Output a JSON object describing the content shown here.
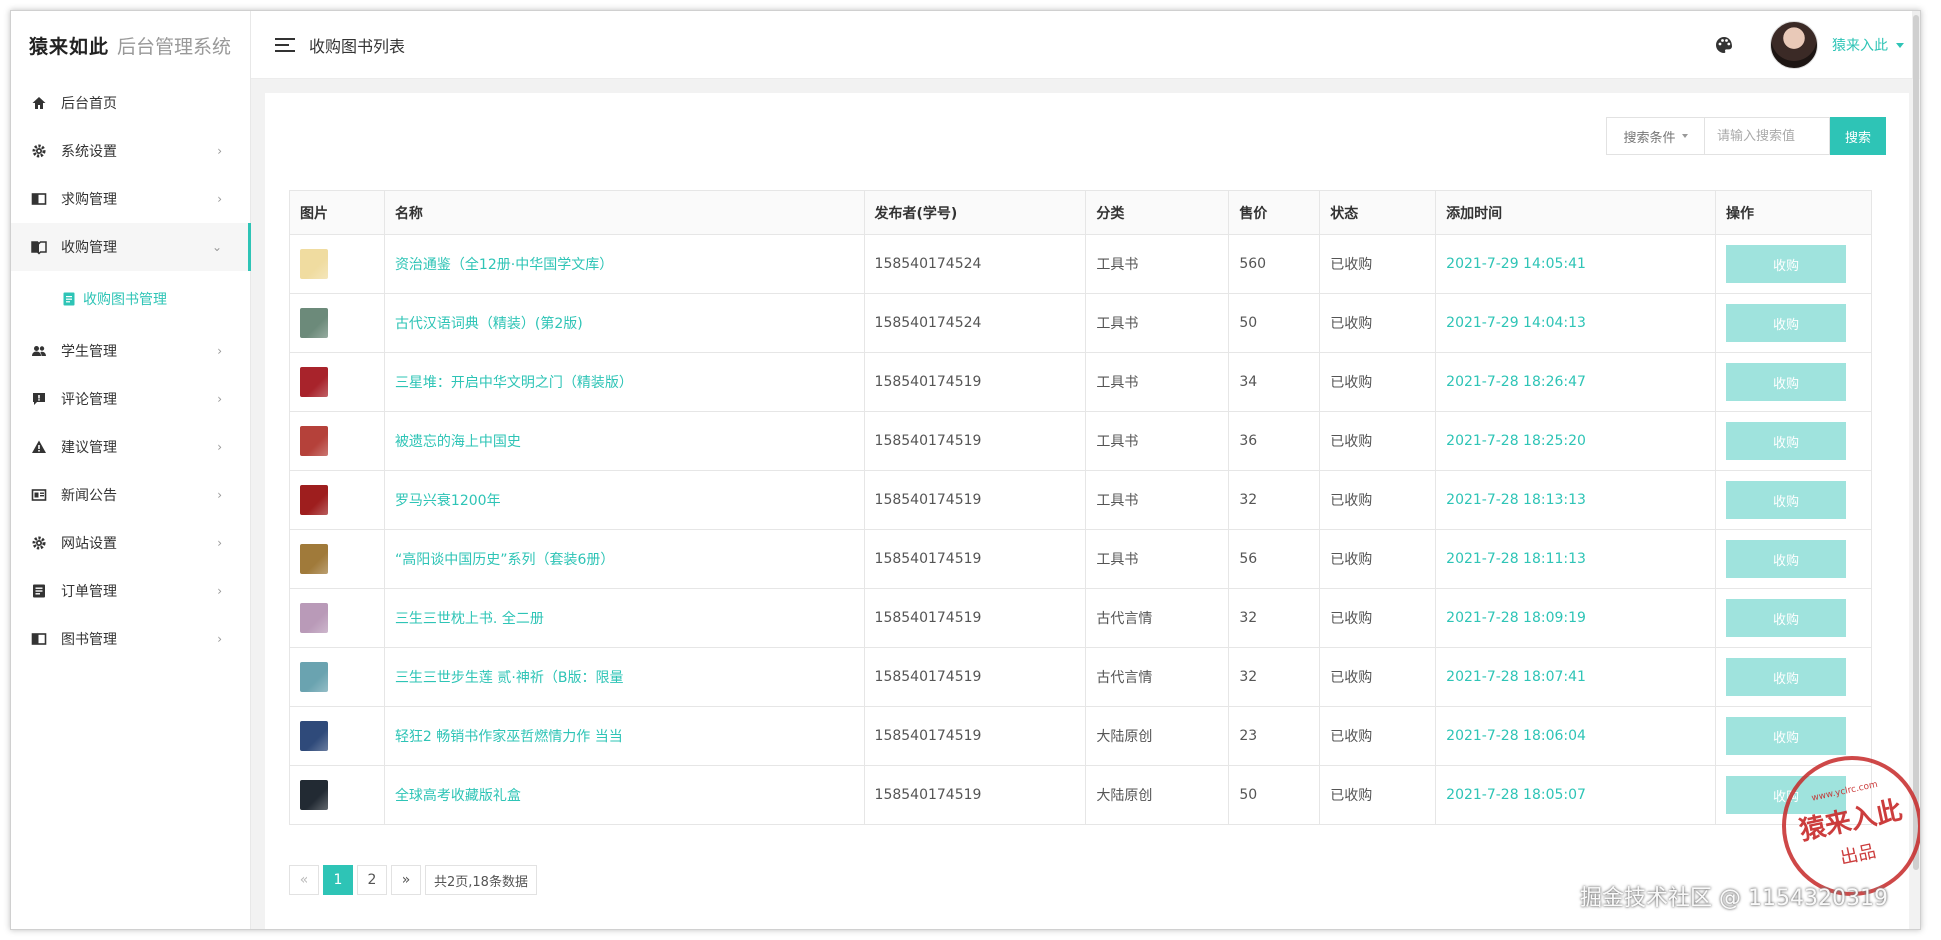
{
  "logo": {
    "brand": "猿来如此",
    "system": "后台管理系统"
  },
  "header": {
    "title": "收购图书列表",
    "user_name": "猿来入此"
  },
  "sidebar": {
    "items": [
      {
        "label": "后台首页",
        "icon": "home-icon",
        "chevron": ""
      },
      {
        "label": "系统设置",
        "icon": "gear-icon",
        "chevron": "›"
      },
      {
        "label": "求购管理",
        "icon": "book-icon",
        "chevron": "›"
      },
      {
        "label": "收购管理",
        "icon": "open-book-icon",
        "chevron": "⌄"
      },
      {
        "label": "学生管理",
        "icon": "users-icon",
        "chevron": "›"
      },
      {
        "label": "评论管理",
        "icon": "comment-icon",
        "chevron": "›"
      },
      {
        "label": "建议管理",
        "icon": "warning-icon",
        "chevron": "›"
      },
      {
        "label": "新闻公告",
        "icon": "news-icon",
        "chevron": "›"
      },
      {
        "label": "网站设置",
        "icon": "gear-icon",
        "chevron": "›"
      },
      {
        "label": "订单管理",
        "icon": "list-icon",
        "chevron": "›"
      },
      {
        "label": "图书管理",
        "icon": "book-icon",
        "chevron": "›"
      }
    ],
    "sub_item": "收购图书管理"
  },
  "search": {
    "condition_label": "搜索条件",
    "placeholder": "请输入搜索值",
    "button_label": "搜索"
  },
  "table": {
    "headers": [
      "图片",
      "名称",
      "发布者(学号)",
      "分类",
      "售价",
      "状态",
      "添加时间",
      "操作"
    ],
    "action_label": "收购",
    "rows": [
      {
        "thumb_color": "#f0dca0",
        "name": "资治通鉴（全12册·中华国学文库）",
        "publisher": "158540174524",
        "category": "工具书",
        "price": "560",
        "status": "已收购",
        "time": "2021-7-29 14:05:41"
      },
      {
        "thumb_color": "#6c8a7a",
        "name": "古代汉语词典（精装）(第2版)",
        "publisher": "158540174524",
        "category": "工具书",
        "price": "50",
        "status": "已收购",
        "time": "2021-7-29 14:04:13"
      },
      {
        "thumb_color": "#a8232b",
        "name": "三星堆：开启中华文明之门（精装版）",
        "publisher": "158540174519",
        "category": "工具书",
        "price": "34",
        "status": "已收购",
        "time": "2021-7-28 18:26:47"
      },
      {
        "thumb_color": "#b5413a",
        "name": "被遗忘的海上中国史",
        "publisher": "158540174519",
        "category": "工具书",
        "price": "36",
        "status": "已收购",
        "time": "2021-7-28 18:25:20"
      },
      {
        "thumb_color": "#9e1e1e",
        "name": "罗马兴衰1200年",
        "publisher": "158540174519",
        "category": "工具书",
        "price": "32",
        "status": "已收购",
        "time": "2021-7-28 18:13:13"
      },
      {
        "thumb_color": "#a07a3a",
        "name": "“高阳谈中国历史”系列（套装6册）",
        "publisher": "158540174519",
        "category": "工具书",
        "price": "56",
        "status": "已收购",
        "time": "2021-7-28 18:11:13"
      },
      {
        "thumb_color": "#b99ab8",
        "name": "三生三世枕上书. 全二册",
        "publisher": "158540174519",
        "category": "古代言情",
        "price": "32",
        "status": "已收购",
        "time": "2021-7-28 18:09:19"
      },
      {
        "thumb_color": "#6aa3b0",
        "name": "三生三世步生莲 贰·神祈（B版：限量",
        "publisher": "158540174519",
        "category": "古代言情",
        "price": "32",
        "status": "已收购",
        "time": "2021-7-28 18:07:41"
      },
      {
        "thumb_color": "#2f4a7a",
        "name": "轻狂2 畅销书作家巫哲燃情力作 当当",
        "publisher": "158540174519",
        "category": "大陆原创",
        "price": "23",
        "status": "已收购",
        "time": "2021-7-28 18:06:04"
      },
      {
        "thumb_color": "#222a33",
        "name": "全球高考收藏版礼盒",
        "publisher": "158540174519",
        "category": "大陆原创",
        "price": "50",
        "status": "已收购",
        "time": "2021-7-28 18:05:07"
      }
    ]
  },
  "pagination": {
    "prev": "«",
    "pages": [
      "1",
      "2"
    ],
    "next": "»",
    "info": "共2页,18条数据"
  },
  "colors": {
    "accent": "#2ec4b6",
    "button_disabled": "#9fe3dd"
  },
  "stamp": {
    "url": "www.yclrc.com",
    "main": "猿来入此",
    "sub": "出品"
  },
  "watermark": "掘金技术社区 @ 1154320319"
}
